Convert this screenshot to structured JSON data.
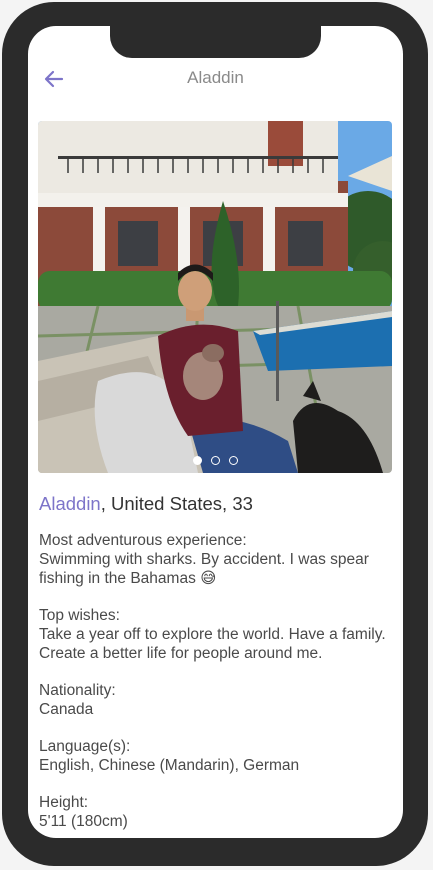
{
  "header": {
    "title": "Aladdin"
  },
  "profile": {
    "name": "Aladdin",
    "location_age": ", United States, 33"
  },
  "photo_carousel": {
    "count": 3,
    "active_index": 0
  },
  "sections": [
    {
      "label": "Most adventurous experience:",
      "value": "Swimming with sharks. By accident. I was spear fishing in the Bahamas 😅"
    },
    {
      "label": "Top wishes:",
      "value": "Take a year off to explore the world. Have a family. Create a better life for people around me."
    },
    {
      "label": "Nationality:",
      "value": "Canada"
    },
    {
      "label": "Language(s):",
      "value": "English, Chinese (Mandarin), German"
    },
    {
      "label": "Height:",
      "value": "5'11 (180cm)"
    }
  ],
  "colors": {
    "accent": "#7d74c9",
    "frame": "#2b2b2b",
    "title_gray": "#8a8a8a",
    "body_text": "#4a4a4a"
  },
  "icons": {
    "back": "arrow-left-icon"
  }
}
